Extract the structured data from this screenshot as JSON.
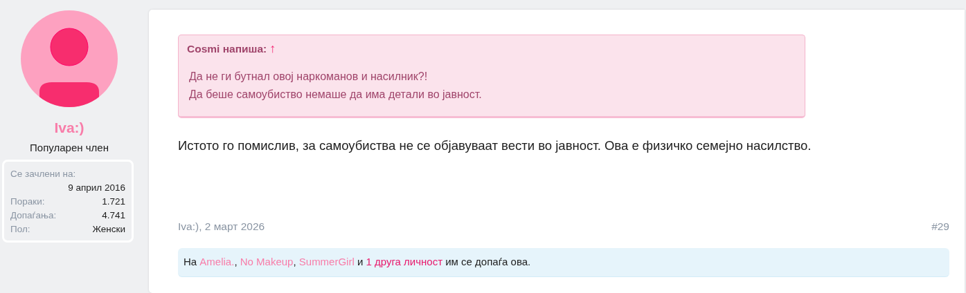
{
  "user": {
    "name": "Iva:)",
    "title": "Популарен член",
    "stats": [
      {
        "label": "Се зачлени на:",
        "value": "9 април 2016",
        "kind": "stacked"
      },
      {
        "label": "Пораки:",
        "value": "1.721",
        "kind": "inline"
      },
      {
        "label": "Допаѓања:",
        "value": "4.741",
        "kind": "inline"
      },
      {
        "label": "Пол:",
        "value": "Женски",
        "kind": "inline"
      }
    ]
  },
  "post": {
    "quote": {
      "author": "Cosmi напиша:",
      "jump": "↑",
      "lines": [
        "Да не ги бутнал овој наркоманов и насилник?!",
        "Да беше самоубиство немаше да има детали во јавност."
      ]
    },
    "body": "Истото го помислив, за самоубиства не се објавуваат вести во јавност. Ова е физичко семејно насилство.",
    "meta": "Iva:), 2 март 2026",
    "number": "#29",
    "likes": [
      {
        "kind": "text",
        "text": "На "
      },
      {
        "kind": "user",
        "text": "Amelia."
      },
      {
        "kind": "text",
        "text": ", "
      },
      {
        "kind": "user",
        "text": "No Makeup"
      },
      {
        "kind": "text",
        "text": ", "
      },
      {
        "kind": "user",
        "text": "SummerGirl"
      },
      {
        "kind": "text",
        "text": " и "
      },
      {
        "kind": "more",
        "text": "1 друга личност"
      },
      {
        "kind": "text",
        "text": " им се допаѓа ова."
      }
    ]
  }
}
